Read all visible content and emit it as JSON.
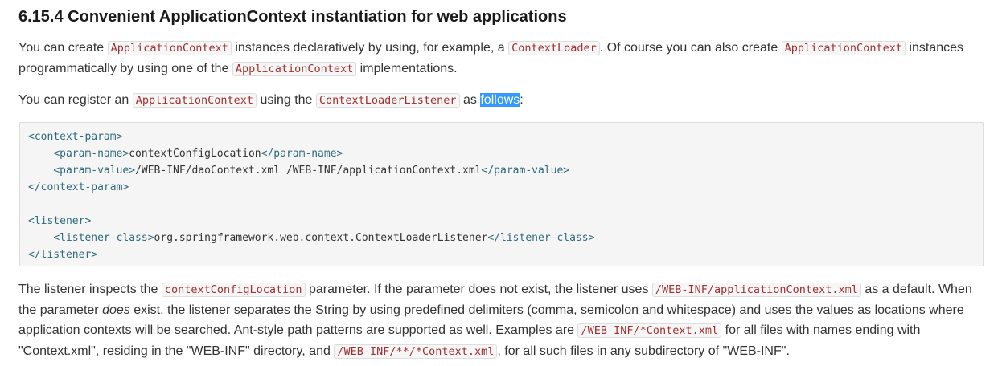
{
  "heading": "6.15.4 Convenient ApplicationContext instantiation for web applications",
  "para1": {
    "t1": "You can create ",
    "c1": "ApplicationContext",
    "t2": " instances declaratively by using, for example, a ",
    "c2": "ContextLoader",
    "t3": ". Of course you can also create ",
    "c3": "ApplicationContext",
    "t4": " instances programmatically by using one of the ",
    "c4": "ApplicationContext",
    "t5": " implementations."
  },
  "para2": {
    "t1": "You can register an ",
    "c1": "ApplicationContext",
    "t2": " using the ",
    "c2": "ContextLoaderListener",
    "t3": " as ",
    "selected": "follows",
    "t4": ":"
  },
  "code": {
    "cp_open": "<context-param>",
    "pn_open": "<param-name>",
    "pn_value": "contextConfigLocation",
    "pn_close": "</param-name>",
    "pv_open": "<param-value>",
    "pv_value": "/WEB-INF/daoContext.xml /WEB-INF/applicationContext.xml",
    "pv_close": "</param-value>",
    "cp_close": "</context-param>",
    "l_open": "<listener>",
    "lc_open": "<listener-class>",
    "lc_value": "org.springframework.web.context.ContextLoaderListener",
    "lc_close": "</listener-class>",
    "l_close": "</listener>"
  },
  "para3": {
    "t1": "The listener inspects the ",
    "c1": "contextConfigLocation",
    "t2": " parameter. If the parameter does not exist, the listener uses ",
    "c2": "/WEB-INF/applicationContext.xml",
    "t3": " as a default. When the parameter ",
    "em": "does",
    "t4": " exist, the listener separates the String by using predefined delimiters (comma, semicolon and whitespace) and uses the values as locations where application contexts will be searched. Ant-style path patterns are supported as well. Examples are ",
    "c3": "/WEB-INF/*Context.xml",
    "t5": " for all files with names ending with \"Context.xml\", residing in the \"WEB-INF\" directory, and ",
    "c4": "/WEB-INF/**/*Context.xml",
    "t6": ", for all such files in any subdirectory of \"WEB-INF\"."
  }
}
